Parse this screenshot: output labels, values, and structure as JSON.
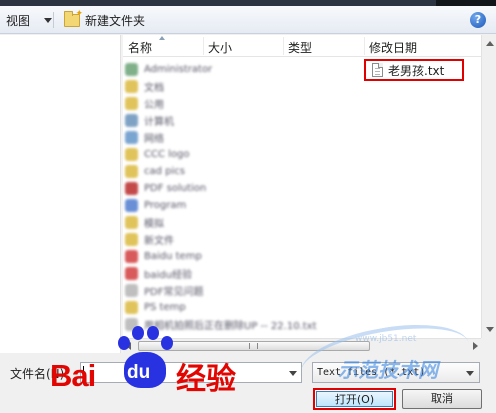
{
  "toolbar": {
    "view_label": "视图",
    "new_folder_label": "新建文件夹",
    "help_label": "?"
  },
  "columns": [
    "名称",
    "大小",
    "类型",
    "修改日期"
  ],
  "blurred_items": [
    {
      "label": "Administrator",
      "color": "#7fb08a"
    },
    {
      "label": "文档",
      "color": "#e0c35a"
    },
    {
      "label": "公用",
      "color": "#e0c35a"
    },
    {
      "label": "计算机",
      "color": "#7fa2c4"
    },
    {
      "label": "网络",
      "color": "#7aa5d0"
    },
    {
      "label": "CCC logo",
      "color": "#e0c35a"
    },
    {
      "label": "cad pics",
      "color": "#e0c35a"
    },
    {
      "label": "PDF solution",
      "color": "#c44a4a"
    },
    {
      "label": "Program",
      "color": "#6a8fd6"
    },
    {
      "label": "模拟",
      "color": "#e0c35a"
    },
    {
      "label": "新文件",
      "color": "#e0c35a"
    },
    {
      "label": "Baidu temp",
      "color": "#d85a5a"
    },
    {
      "label": "baidu经验",
      "color": "#d85a5a"
    },
    {
      "label": "PDF常见问题",
      "color": "#bfbfbf"
    },
    {
      "label": "PS temp",
      "color": "#e0c35a"
    },
    {
      "label": "用相机拍照后正在删除UP -- 22.10.txt",
      "color": "#bfbfbf"
    }
  ],
  "file": {
    "name": "老男孩.txt"
  },
  "bottom": {
    "filename_label": "文件名(N):",
    "filename_value": "",
    "filetype_value": "Text files (*.txt)",
    "open_label": "打开(O)",
    "cancel_label": "取消"
  },
  "watermark": {
    "brand_text": "Bai",
    "brand_du": "du",
    "brand_suffix": "经验",
    "site_text": "示范技术网",
    "site_url": "www.jb51.net"
  },
  "colors": {
    "highlight_red": "#e00000",
    "baidu_blue": "#2932e1",
    "baidu_red": "#e10602"
  }
}
